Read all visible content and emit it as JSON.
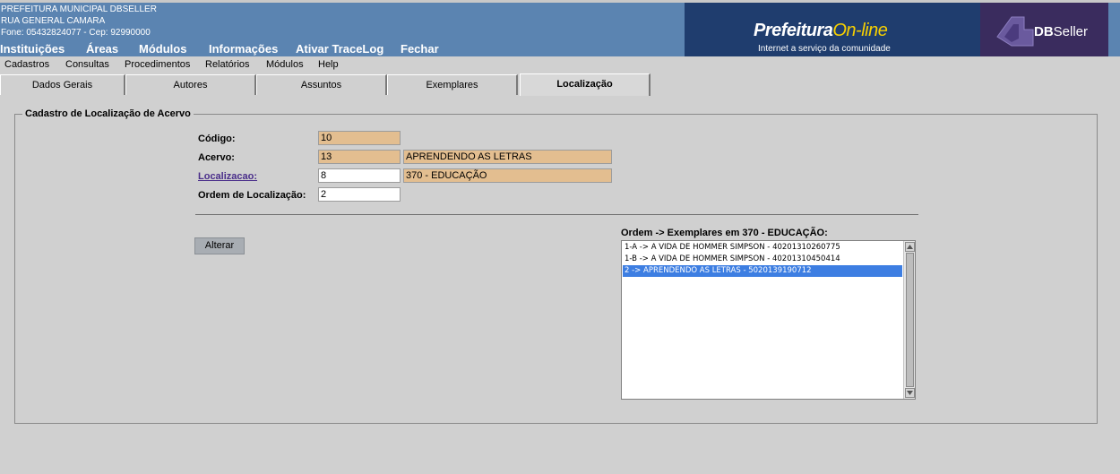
{
  "header": {
    "org_name": "PREFEITURA MUNICIPAL DBSELLER",
    "address": "RUA GENERAL CAMARA",
    "contact": "Fone: 05432824077  -  Cep: 92990000",
    "main_menu": [
      "Instituições",
      "Áreas",
      "Módulos",
      "Informações",
      "Ativar TraceLog",
      "Fechar"
    ],
    "banner_title_main": "Prefeitura",
    "banner_title_accent": "On-line",
    "banner_subtitle": "Internet a serviço da comunidade",
    "brand_db": "DB",
    "brand_seller": "Seller"
  },
  "submenu": [
    "Cadastros",
    "Consultas",
    "Procedimentos",
    "Relatórios",
    "Módulos",
    "Help"
  ],
  "tabs": [
    "Dados Gerais",
    "Autores",
    "Assuntos",
    "Exemplares",
    "Localização"
  ],
  "active_tab": "Localização",
  "form": {
    "legend": "Cadastro de Localização de Acervo",
    "codigo_label": "Código:",
    "codigo_value": "10",
    "acervo_label": "Acervo:",
    "acervo_code": "13",
    "acervo_desc": "APRENDENDO AS LETRAS",
    "localizacao_label": "Localizacao:",
    "localizacao_code": "8",
    "localizacao_desc": "370 - EDUCAÇÃO",
    "ordem_label": "Ordem de Localização:",
    "ordem_value": "2",
    "alterar_label": "Alterar"
  },
  "list": {
    "title": "Ordem -> Exemplares em 370 - EDUCAÇÃO:",
    "items": [
      "1-A -> A VIDA DE HOMMER SIMPSON - 40201310260775",
      "1-B -> A VIDA DE HOMMER SIMPSON - 40201310450414",
      "2 -> APRENDENDO AS LETRAS - 5020139190712"
    ],
    "selected_index": 2
  },
  "colors": {
    "header_bg": "#5b84b1",
    "readonly_field": "#e3be90",
    "selection": "#3d7ee2",
    "page_bg": "#d0d0d0"
  }
}
